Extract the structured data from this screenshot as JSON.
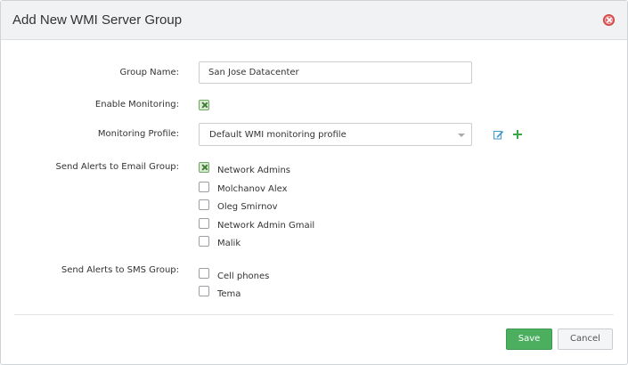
{
  "dialog": {
    "title": "Add New WMI Server Group",
    "close_icon": "close-icon"
  },
  "form": {
    "group_name_label": "Group Name:",
    "group_name_value": "San Jose Datacenter",
    "enable_monitoring_label": "Enable Monitoring:",
    "enable_monitoring_checked": true,
    "monitoring_profile_label": "Monitoring Profile:",
    "monitoring_profile_value": "Default WMI monitoring profile",
    "email_group_label": "Send Alerts to Email Group:",
    "email_groups": [
      {
        "label": "Network Admins",
        "checked": true
      },
      {
        "label": "Molchanov Alex",
        "checked": false
      },
      {
        "label": "Oleg Smirnov",
        "checked": false
      },
      {
        "label": "Network Admin Gmail",
        "checked": false
      },
      {
        "label": "Malik",
        "checked": false
      }
    ],
    "sms_group_label": "Send Alerts to SMS Group:",
    "sms_groups": [
      {
        "label": "Cell phones",
        "checked": false
      },
      {
        "label": "Tema",
        "checked": false
      }
    ]
  },
  "footer": {
    "save_label": "Save",
    "cancel_label": "Cancel"
  },
  "colors": {
    "accent_green": "#4caf5f",
    "check_green": "#3f7f33",
    "close_red": "#e25757",
    "edit_blue": "#3d9ad1"
  },
  "icons": {
    "edit": "edit-icon",
    "add": "plus-icon",
    "dropdown": "chevron-down-icon"
  }
}
